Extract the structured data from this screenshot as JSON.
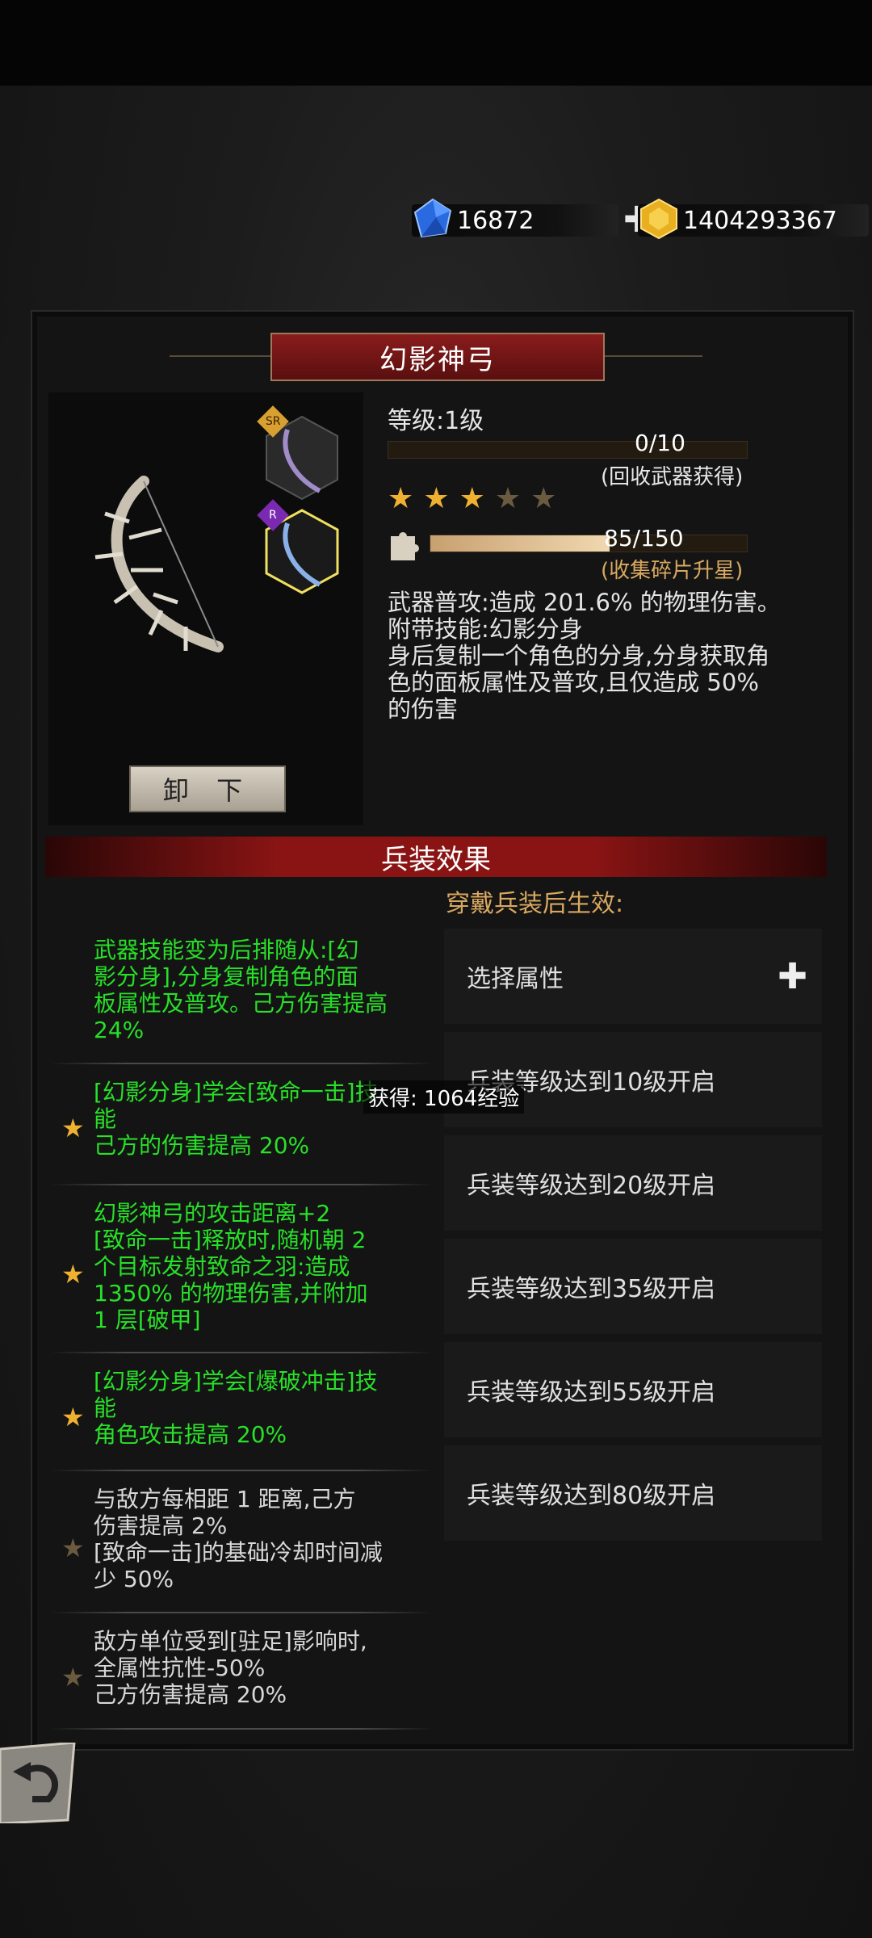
{
  "currency": {
    "gems": "16872",
    "gold": "1404293367",
    "plus_label": "✚"
  },
  "weapon": {
    "name": "幻影神弓",
    "unequip_label": "卸 下",
    "badge_sr": "SR",
    "badge_r": "R"
  },
  "level": {
    "label": "等级:1级",
    "progress_text": "0/10",
    "progress_note": "(回收武器获得)",
    "progress_value": 0
  },
  "stars": {
    "filled": 3,
    "total": 5,
    "filled_color": "#f0b030",
    "empty_color": "#6a5a40"
  },
  "fragments": {
    "progress_text": "85/150",
    "note": "(收集碎片升星)",
    "value": 0.567
  },
  "description": [
    "武器普攻:造成 201.6% 的物理伤害。",
    "附带技能:幻影分身",
    "身后复制一个角色的分身,分身获取角",
    "色的面板属性及普攻,且仅造成 50%",
    "的伤害"
  ],
  "effects": {
    "title": "兵装效果",
    "wear_note": "穿戴兵装后生效:",
    "left": [
      {
        "lines": [
          "武器技能变为后排随从:[幻",
          "影分身],分身复制角色的面",
          "板属性及普攻。己方伤害提高",
          "24%"
        ],
        "active": true,
        "star": false
      },
      {
        "lines": [
          "[幻影分身]学会[致命一击]技",
          "能",
          "己方的伤害提高 20%"
        ],
        "active": true,
        "star": true
      },
      {
        "lines": [
          "幻影神弓的攻击距离+2",
          "[致命一击]释放时,随机朝 2",
          "个目标发射致命之羽:造成",
          "1350% 的物理伤害,并附加",
          "1 层[破甲]"
        ],
        "active": true,
        "star": true
      },
      {
        "lines": [
          "[幻影分身]学会[爆破冲击]技",
          "能",
          "角色攻击提高 20%"
        ],
        "active": true,
        "star": true
      },
      {
        "lines": [
          "与敌方每相距 1 距离,己方",
          "伤害提高 2%",
          "[致命一击]的基础冷却时间减",
          "少 50%"
        ],
        "active": false,
        "star": true
      },
      {
        "lines": [
          "敌方单位受到[驻足]影响时,",
          "全属性抗性-50%",
          "己方伤害提高 20%"
        ],
        "active": false,
        "star": true
      }
    ],
    "right": [
      {
        "label": "选择属性",
        "plus": true
      },
      {
        "label": "兵装等级达到10级开启",
        "plus": false
      },
      {
        "label": "兵装等级达到20级开启",
        "plus": false
      },
      {
        "label": "兵装等级达到35级开启",
        "plus": false
      },
      {
        "label": "兵装等级达到55级开启",
        "plus": false
      },
      {
        "label": "兵装等级达到80级开启",
        "plus": false
      }
    ]
  },
  "toast": "获得: 1064经验",
  "colors": {
    "active_text": "#28e028",
    "inactive_text": "#d8d8d8",
    "accent_gold": "#d8a860"
  }
}
